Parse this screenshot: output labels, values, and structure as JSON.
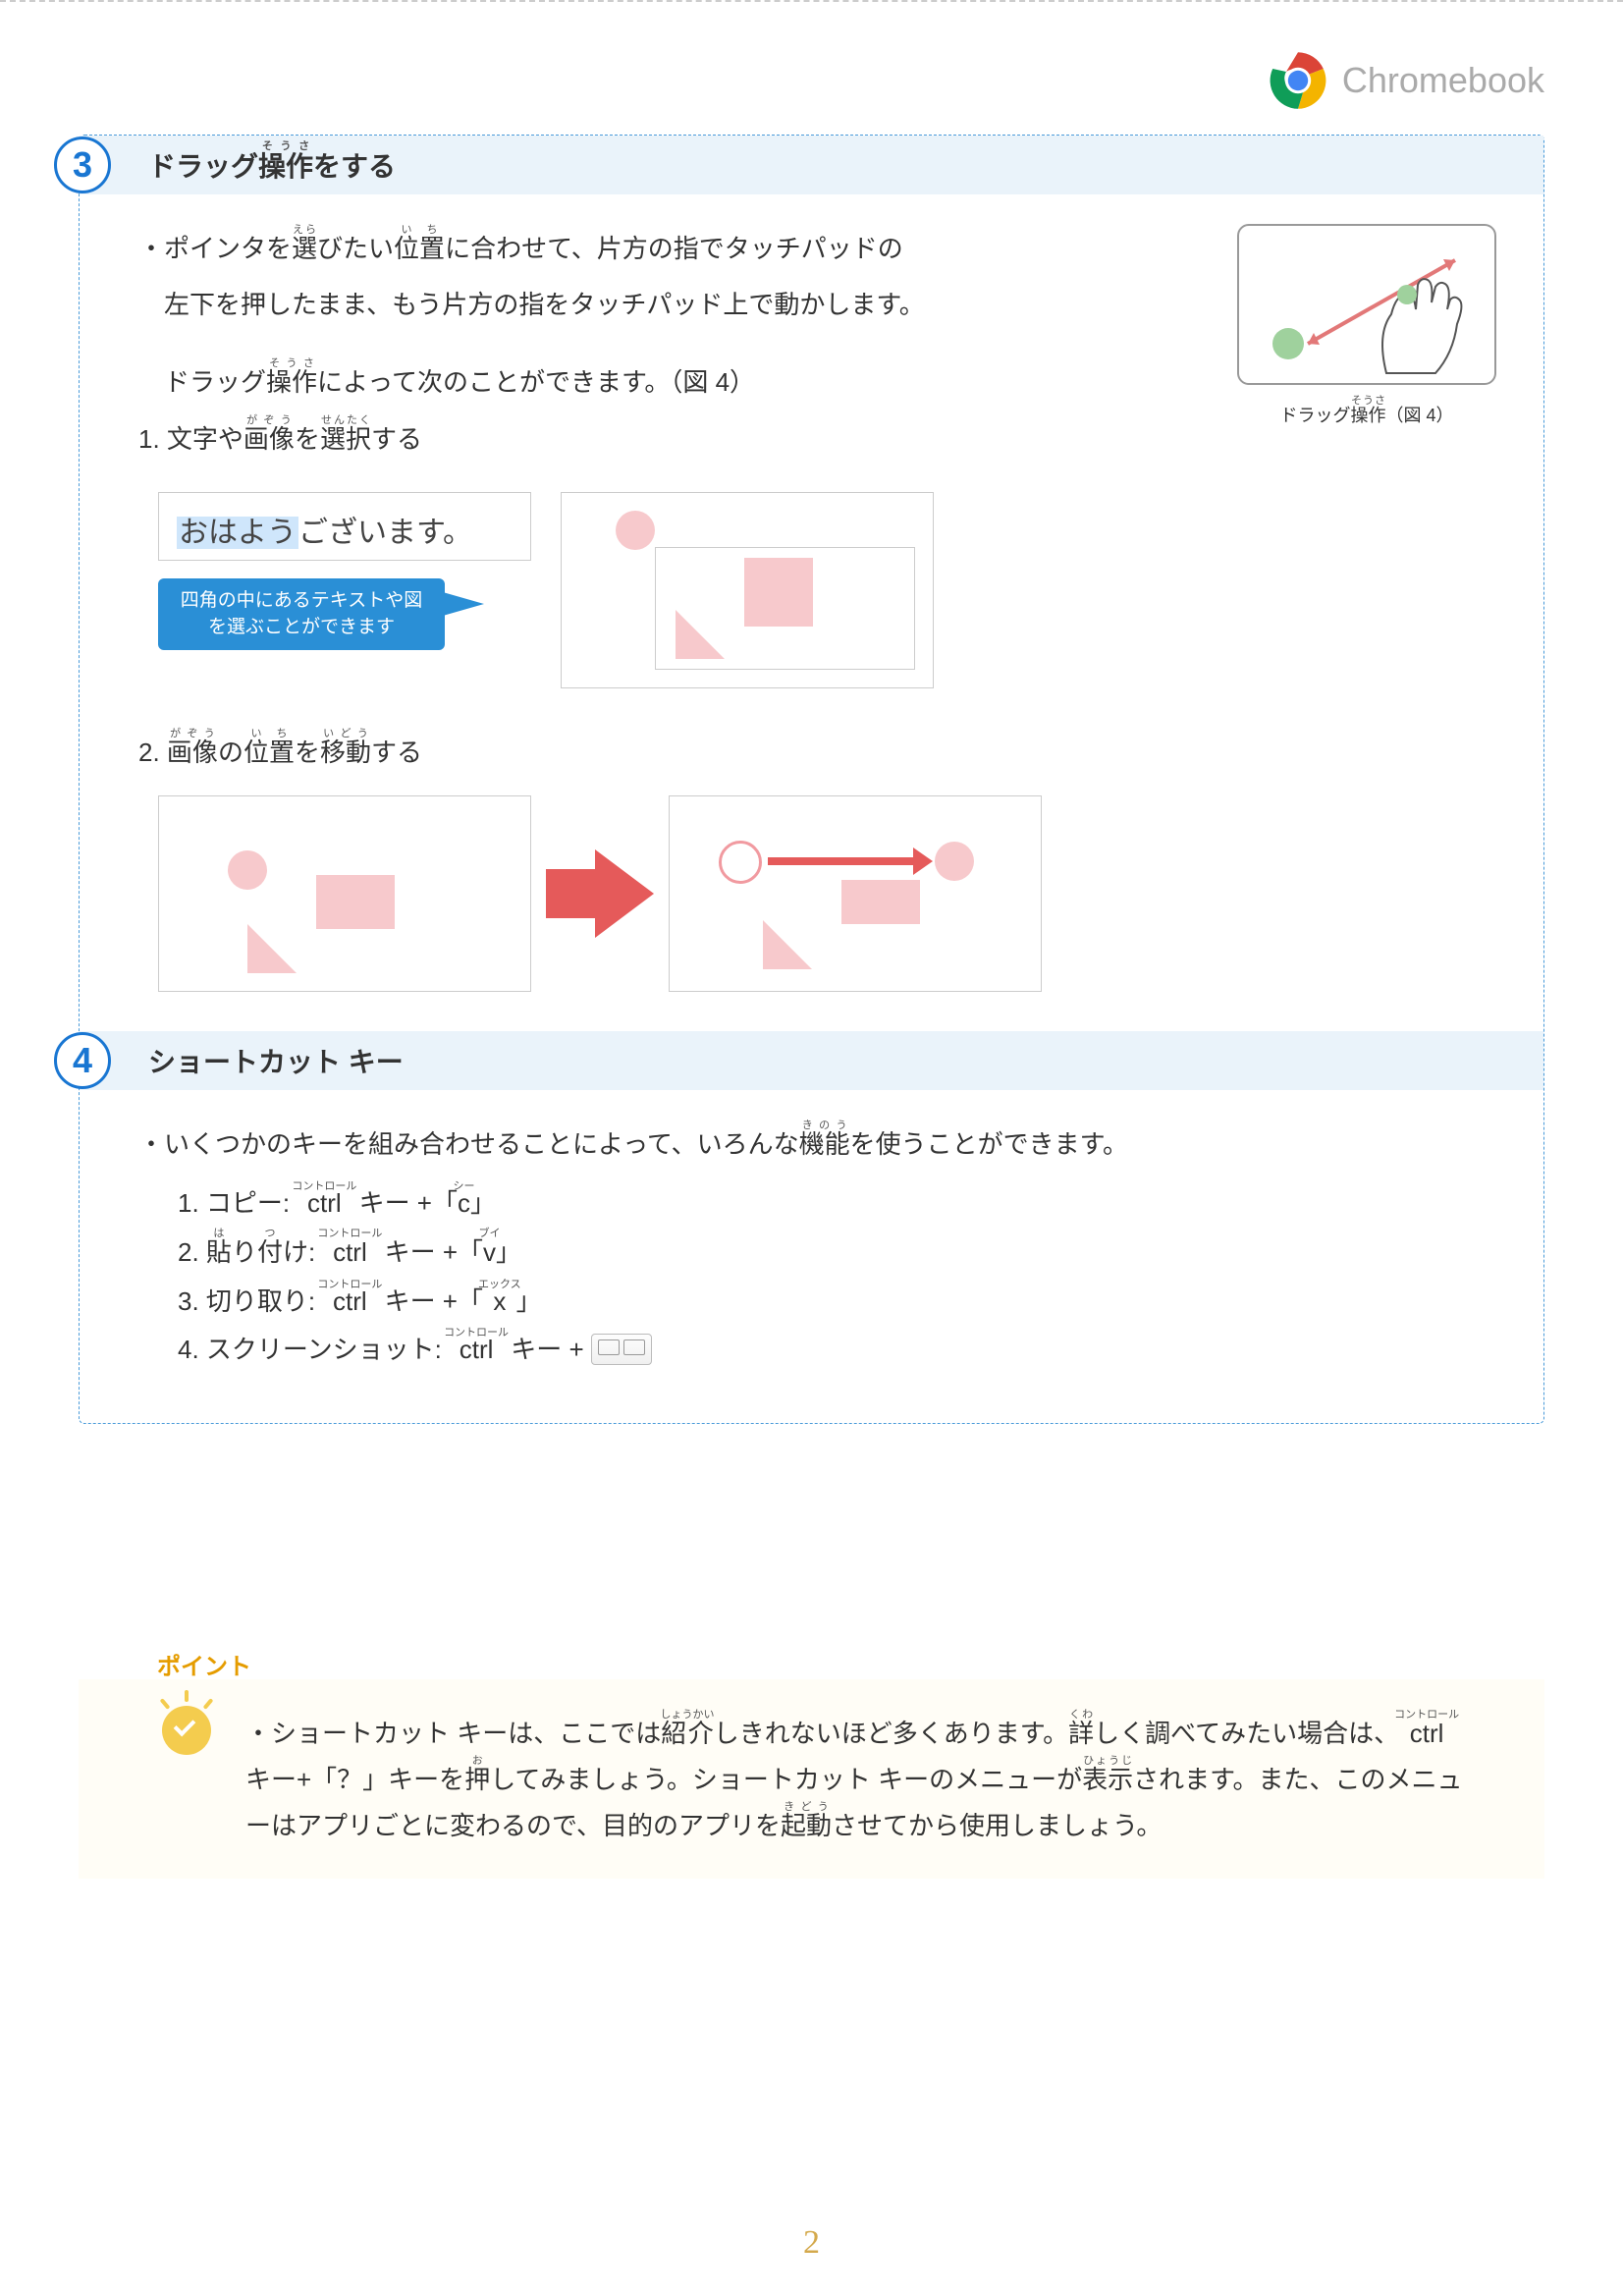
{
  "header": {
    "brand": "Chromebook"
  },
  "section3": {
    "num": "3",
    "title": "ドラッグ操作をする",
    "p1_line1": "・ポインタを選びたい位置に合わせて、片方の指でタッチパッドの",
    "p1_line2": "　左下を押したまま、もう片方の指をタッチパッド上で動かします。",
    "p2": "　ドラッグ操作によって次のことができます。（図 4）",
    "fig_caption": "ドラッグ操作（図 4）",
    "item1": "1. 文字や画像を選択する",
    "example_text_hl": "おはよう",
    "example_text_rest": "ございます。",
    "callout": "四角の中にあるテキストや図を選ぶことができます",
    "item2": "2. 画像の位置を移動する"
  },
  "section4": {
    "num": "4",
    "title": "ショートカット キー",
    "intro": "・いくつかのキーを組み合わせることによって、いろんな機能を使うことができます。",
    "s1": "1. コピー: ctrl キー +「c」",
    "s2": "2. 貼り付け: ctrl キー +「v」",
    "s3": "3. 切り取り: ctrl キー +「x」",
    "s4_a": "4. スクリーンショット: ctrl キー + ",
    "s4_b": ""
  },
  "point": {
    "label": "ポイント",
    "text": "・ショートカット キーは、ここでは紹介しきれないほど多くあります。詳しく調べてみたい場合は、ctrl キー+「？」キーを押してみましょう。ショートカット キーのメニューが表示されます。また、このメニューはアプリごとに変わるので、目的のアプリを起動させてから使用しましょう。"
  },
  "pageNumber": "2",
  "ruby": {
    "sousa": "そうさ",
    "era": "えら",
    "ichi": "いち",
    "gazou": "がぞう",
    "sentaku": "せんたく",
    "idou": "いどう",
    "kinou": "きのう",
    "control": "コントロール",
    "c": "シー",
    "v": "ブイ",
    "x": "エックス",
    "ha": "は",
    "tsu": "つ",
    "shoukai": "しょうかい",
    "kuwa": "くわ",
    "o": "お",
    "hyouji": "ひょうじ",
    "kidou": "きどう"
  }
}
